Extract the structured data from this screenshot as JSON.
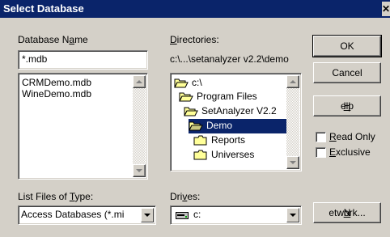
{
  "window": {
    "title": "Select Database",
    "close_glyph": "✕"
  },
  "database_name": {
    "label_pre": "Database N",
    "label_key": "a",
    "label_post": "me",
    "value": "*.mdb",
    "files": [
      "CRMDemo.mdb",
      "WineDemo.mdb"
    ]
  },
  "directories": {
    "label_pre": "",
    "label_key": "D",
    "label_post": "irectories:",
    "current_path": "c:\\...\\setanalyzer v2.2\\demo",
    "tree": [
      {
        "label": "c:\\",
        "state": "open"
      },
      {
        "label": "Program Files",
        "state": "open"
      },
      {
        "label": "SetAnalyzer V2.2",
        "state": "open"
      },
      {
        "label": "Demo",
        "state": "open-selected"
      },
      {
        "label": "Reports",
        "state": "closed"
      },
      {
        "label": "Universes",
        "state": "closed"
      }
    ]
  },
  "file_type": {
    "label_pre": "List Files of ",
    "label_key": "T",
    "label_post": "ype:",
    "value": "Access Databases (*.mdb)",
    "visible_value": "Access Databases (*.mi"
  },
  "drives": {
    "label_pre": "Dri",
    "label_key": "v",
    "label_post": "es:",
    "value": "c:"
  },
  "buttons": {
    "ok": "OK",
    "cancel": "Cancel",
    "help_pre": "",
    "help_key": "H",
    "help_post": "elp",
    "network_pre": "",
    "network_key": "N",
    "network_post": "etwork..."
  },
  "options": {
    "read_only": {
      "pre": "",
      "key": "R",
      "post": "ead Only",
      "checked": false
    },
    "exclusive": {
      "pre": "",
      "key": "E",
      "post": "xclusive",
      "checked": false
    }
  },
  "colors": {
    "titlebar": "#0a246a",
    "face": "#d4d0c8",
    "folder": "#ffff99"
  }
}
